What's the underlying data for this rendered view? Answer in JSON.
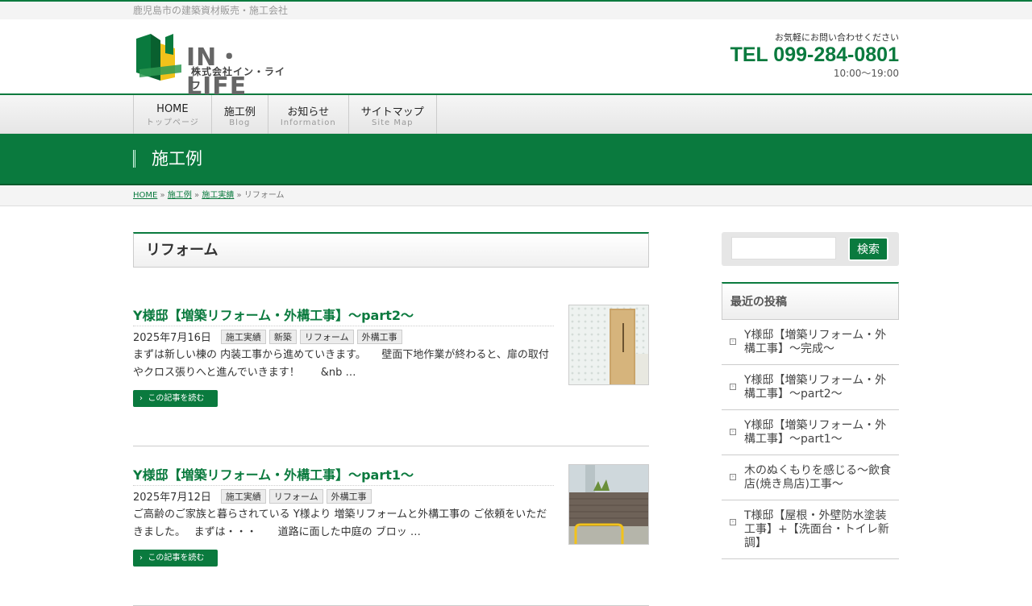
{
  "topbar": {
    "tagline": "鹿児島市の建築資材販売・施工会社"
  },
  "logo": {
    "name": "IN・LIFE",
    "sub": "株式会社イン・ライフ"
  },
  "contact": {
    "lead": "お気軽にお問い合わせください",
    "tel": "TEL 099-284-0801",
    "hours": "10:00〜19:00"
  },
  "nav": [
    {
      "main": "HOME",
      "en": "トップページ"
    },
    {
      "main": "施工例",
      "en": "Blog"
    },
    {
      "main": "お知らせ",
      "en": "Information"
    },
    {
      "main": "サイトマップ",
      "en": "Site Map"
    }
  ],
  "page_title": "施工例",
  "breadcrumb": {
    "home": "HOME",
    "sep": "»",
    "c1": "施工例",
    "c2": "施工実績",
    "current": "リフォーム"
  },
  "category_title": "リフォーム",
  "posts": [
    {
      "title": "Y様邸【増築リフォーム・外構工事】～part2～",
      "date": "2025年7月16日",
      "tags": [
        "施工実績",
        "新築",
        "リフォーム",
        "外構工事"
      ],
      "excerpt": "まずは新しい棟の 内装工事から進めていきます。　　壁面下地作業が終わると、扉の取付やクロス張りへと進んでいきます！　　&nb …",
      "readmore": "この記事を読む"
    },
    {
      "title": "Y様邸【増築リフォーム・外構工事】～part1～",
      "date": "2025年7月12日",
      "tags": [
        "施工実績",
        "リフォーム",
        "外構工事"
      ],
      "excerpt": "ご高齢のご家族と暮らされている Y様より 増築リフォームと外構工事の ご依頼をいただきました。　 まずは・・・　　道路に面した中庭の ブロッ …",
      "readmore": "この記事を読む"
    }
  ],
  "search": {
    "placeholder": "",
    "button": "検索"
  },
  "recent": {
    "title": "最近の投稿",
    "items": [
      "Y様邸【増築リフォーム・外構工事】～完成～",
      "Y様邸【増築リフォーム・外構工事】～part2～",
      "Y様邸【増築リフォーム・外構工事】～part1～",
      "木のぬくもりを感じる～飲食店(焼き鳥店)工事～",
      "T様邸【屋根・外壁防水塗装工事】+【洗面台・トイレ新調】"
    ]
  },
  "colors": {
    "brand_green": "#0a7a3e",
    "logo_yellow": "#f2c21b"
  }
}
